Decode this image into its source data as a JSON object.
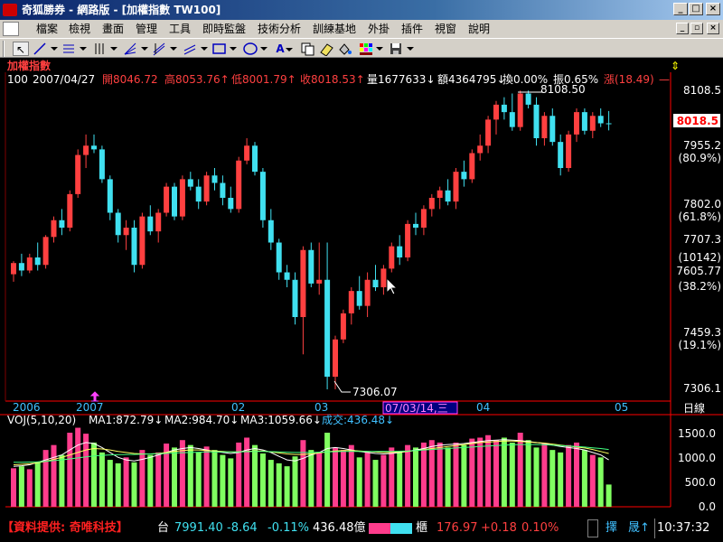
{
  "window": {
    "title": "奇狐勝券 - 網路版 - [加權指數 TW100]",
    "minimize": "_",
    "maximize": "□",
    "close": "×"
  },
  "menu": [
    "檔案",
    "檢視",
    "畫面",
    "管理",
    "工具",
    "即時監盤",
    "技術分析",
    "訓練基地",
    "外掛",
    "插件",
    "視窗",
    "說明"
  ],
  "mdi": {
    "minimize": "_",
    "restore": "▫",
    "close": "×"
  },
  "toolbar": {
    "a_label": "A",
    "arrow": "↖"
  },
  "header": {
    "name": "加權指數",
    "anchor": "⇕",
    "period": "100",
    "date": "2007/04/27",
    "open": "開8046.72",
    "high": "高8053.76↑",
    "low": "低8001.79↑",
    "close": "收8018.53↑",
    "volume": "量1677633↓",
    "amount": "額4364795↓",
    "turnover": "換0.00%",
    "amplitude": "振0.65%",
    "change": "漲(18.49)",
    "change_end": "—"
  },
  "chart_data": {
    "type": "candlestick",
    "price_axis": {
      "labels": [
        "8108.5",
        "7955.2",
        "(80.9%)",
        "7802.0",
        "(61.8%)",
        "7707.3",
        "(10142)",
        "7605.77",
        "(38.2%)",
        "7459.3",
        "(19.1%)",
        "7306.1"
      ],
      "range": [
        7306.1,
        8108.5
      ],
      "current": "8018.5"
    },
    "annotations": {
      "high": "8108.50",
      "low": "7306.07"
    },
    "time_axis": {
      "labels": [
        "2006",
        "2007",
        "02",
        "03",
        "07/03/14,三",
        "04",
        "05"
      ],
      "period": "日線"
    },
    "indicator_header": {
      "name": "VOJ(5,10,20)",
      "ma1": "MA1:872.79↓",
      "ma2": "MA2:984.70↓",
      "ma3": "MA3:1059.66↓",
      "deal": "成交:436.48↓"
    },
    "volume_axis": {
      "labels": [
        "1500.0",
        "1000.0",
        "500.0",
        "0.0"
      ],
      "range": [
        0,
        1500
      ]
    },
    "candles": [
      {
        "o": 7615,
        "h": 7650,
        "l": 7595,
        "c": 7645
      },
      {
        "o": 7645,
        "h": 7670,
        "l": 7610,
        "c": 7625
      },
      {
        "o": 7625,
        "h": 7670,
        "l": 7618,
        "c": 7660
      },
      {
        "o": 7660,
        "h": 7700,
        "l": 7625,
        "c": 7640
      },
      {
        "o": 7640,
        "h": 7720,
        "l": 7630,
        "c": 7715
      },
      {
        "o": 7715,
        "h": 7770,
        "l": 7700,
        "c": 7760
      },
      {
        "o": 7760,
        "h": 7790,
        "l": 7720,
        "c": 7740
      },
      {
        "o": 7740,
        "h": 7840,
        "l": 7730,
        "c": 7830
      },
      {
        "o": 7830,
        "h": 7950,
        "l": 7820,
        "c": 7935
      },
      {
        "o": 7935,
        "h": 7990,
        "l": 7900,
        "c": 7960
      },
      {
        "o": 7960,
        "h": 7990,
        "l": 7940,
        "c": 7950
      },
      {
        "o": 7950,
        "h": 7960,
        "l": 7860,
        "c": 7870
      },
      {
        "o": 7870,
        "h": 7880,
        "l": 7760,
        "c": 7780
      },
      {
        "o": 7780,
        "h": 7790,
        "l": 7700,
        "c": 7720
      },
      {
        "o": 7720,
        "h": 7760,
        "l": 7680,
        "c": 7740
      },
      {
        "o": 7740,
        "h": 7760,
        "l": 7620,
        "c": 7640
      },
      {
        "o": 7640,
        "h": 7780,
        "l": 7630,
        "c": 7770
      },
      {
        "o": 7770,
        "h": 7800,
        "l": 7720,
        "c": 7730
      },
      {
        "o": 7730,
        "h": 7790,
        "l": 7700,
        "c": 7780
      },
      {
        "o": 7780,
        "h": 7860,
        "l": 7770,
        "c": 7850
      },
      {
        "o": 7850,
        "h": 7860,
        "l": 7760,
        "c": 7770
      },
      {
        "o": 7770,
        "h": 7880,
        "l": 7760,
        "c": 7870
      },
      {
        "o": 7870,
        "h": 7890,
        "l": 7840,
        "c": 7850
      },
      {
        "o": 7850,
        "h": 7870,
        "l": 7790,
        "c": 7810
      },
      {
        "o": 7810,
        "h": 7890,
        "l": 7800,
        "c": 7880
      },
      {
        "o": 7880,
        "h": 7900,
        "l": 7840,
        "c": 7860
      },
      {
        "o": 7860,
        "h": 7880,
        "l": 7800,
        "c": 7820
      },
      {
        "o": 7820,
        "h": 7850,
        "l": 7780,
        "c": 7790
      },
      {
        "o": 7790,
        "h": 7930,
        "l": 7780,
        "c": 7920
      },
      {
        "o": 7920,
        "h": 7980,
        "l": 7910,
        "c": 7960
      },
      {
        "o": 7960,
        "h": 7970,
        "l": 7880,
        "c": 7890
      },
      {
        "o": 7890,
        "h": 7900,
        "l": 7740,
        "c": 7760
      },
      {
        "o": 7760,
        "h": 7790,
        "l": 7680,
        "c": 7700
      },
      {
        "o": 7700,
        "h": 7710,
        "l": 7600,
        "c": 7620
      },
      {
        "o": 7620,
        "h": 7640,
        "l": 7580,
        "c": 7600
      },
      {
        "o": 7600,
        "h": 7620,
        "l": 7480,
        "c": 7500
      },
      {
        "o": 7500,
        "h": 7690,
        "l": 7400,
        "c": 7680
      },
      {
        "o": 7680,
        "h": 7700,
        "l": 7580,
        "c": 7590
      },
      {
        "o": 7590,
        "h": 7700,
        "l": 7560,
        "c": 7600
      },
      {
        "o": 7600,
        "h": 7700,
        "l": 7306,
        "c": 7340
      },
      {
        "o": 7340,
        "h": 7450,
        "l": 7306,
        "c": 7440
      },
      {
        "o": 7440,
        "h": 7520,
        "l": 7430,
        "c": 7510
      },
      {
        "o": 7510,
        "h": 7580,
        "l": 7480,
        "c": 7570
      },
      {
        "o": 7570,
        "h": 7610,
        "l": 7520,
        "c": 7530
      },
      {
        "o": 7530,
        "h": 7620,
        "l": 7500,
        "c": 7600
      },
      {
        "o": 7600,
        "h": 7640,
        "l": 7570,
        "c": 7580
      },
      {
        "o": 7580,
        "h": 7640,
        "l": 7560,
        "c": 7630
      },
      {
        "o": 7630,
        "h": 7700,
        "l": 7620,
        "c": 7690
      },
      {
        "o": 7690,
        "h": 7720,
        "l": 7640,
        "c": 7660
      },
      {
        "o": 7660,
        "h": 7760,
        "l": 7650,
        "c": 7750
      },
      {
        "o": 7750,
        "h": 7780,
        "l": 7720,
        "c": 7740
      },
      {
        "o": 7740,
        "h": 7800,
        "l": 7720,
        "c": 7790
      },
      {
        "o": 7790,
        "h": 7830,
        "l": 7770,
        "c": 7820
      },
      {
        "o": 7820,
        "h": 7850,
        "l": 7790,
        "c": 7840
      },
      {
        "o": 7840,
        "h": 7870,
        "l": 7800,
        "c": 7810
      },
      {
        "o": 7810,
        "h": 7900,
        "l": 7790,
        "c": 7890
      },
      {
        "o": 7890,
        "h": 7920,
        "l": 7850,
        "c": 7870
      },
      {
        "o": 7870,
        "h": 7950,
        "l": 7860,
        "c": 7940
      },
      {
        "o": 7940,
        "h": 7990,
        "l": 7920,
        "c": 7960
      },
      {
        "o": 7960,
        "h": 8040,
        "l": 7940,
        "c": 8030
      },
      {
        "o": 8030,
        "h": 8080,
        "l": 7990,
        "c": 8070
      },
      {
        "o": 8070,
        "h": 8090,
        "l": 8030,
        "c": 8050
      },
      {
        "o": 8050,
        "h": 8100,
        "l": 8000,
        "c": 8010
      },
      {
        "o": 8010,
        "h": 8108,
        "l": 8000,
        "c": 8100
      },
      {
        "o": 8100,
        "h": 8108,
        "l": 8060,
        "c": 8070
      },
      {
        "o": 8070,
        "h": 8090,
        "l": 7960,
        "c": 7980
      },
      {
        "o": 7980,
        "h": 8050,
        "l": 7960,
        "c": 8040
      },
      {
        "o": 8040,
        "h": 8060,
        "l": 7960,
        "c": 7970
      },
      {
        "o": 7970,
        "h": 7990,
        "l": 7880,
        "c": 7900
      },
      {
        "o": 7900,
        "h": 8000,
        "l": 7890,
        "c": 7990
      },
      {
        "o": 7990,
        "h": 8060,
        "l": 7970,
        "c": 8050
      },
      {
        "o": 8050,
        "h": 8060,
        "l": 7990,
        "c": 8000
      },
      {
        "o": 8000,
        "h": 8050,
        "l": 7980,
        "c": 8040
      },
      {
        "o": 8040,
        "h": 8060,
        "l": 8010,
        "c": 8020
      },
      {
        "o": 8020,
        "h": 8053,
        "l": 8001,
        "c": 8018
      }
    ],
    "volumes": [
      780,
      820,
      760,
      900,
      1150,
      1250,
      1050,
      1500,
      1600,
      1480,
      1300,
      1100,
      950,
      880,
      1000,
      900,
      1150,
      1050,
      1100,
      1280,
      1200,
      1350,
      1250,
      1100,
      1220,
      1150,
      1050,
      980,
      1300,
      1400,
      1250,
      1080,
      950,
      880,
      820,
      1020,
      1350,
      1150,
      1100,
      1500,
      1200,
      1150,
      1250,
      1000,
      1100,
      950,
      1050,
      1200,
      1100,
      1250,
      1200,
      1300,
      1350,
      1300,
      1200,
      1300,
      1250,
      1380,
      1400,
      1450,
      1350,
      1400,
      1300,
      1500,
      1350,
      1200,
      1280,
      1150,
      1100,
      1250,
      1300,
      1150,
      1050,
      1000,
      450
    ],
    "ma1": [
      820,
      830,
      850,
      900,
      950,
      1000,
      1050,
      1150,
      1250,
      1300,
      1280,
      1200,
      1100,
      1000,
      950,
      930,
      960,
      1000,
      1050,
      1100,
      1150,
      1180,
      1200,
      1180,
      1150,
      1120,
      1100,
      1080,
      1100,
      1150,
      1180,
      1150,
      1100,
      1020,
      950,
      930,
      980,
      1050,
      1100,
      1180,
      1200,
      1180,
      1150,
      1120,
      1100,
      1080,
      1070,
      1080,
      1100,
      1120,
      1150,
      1180,
      1220,
      1250,
      1260,
      1270,
      1280,
      1300,
      1320,
      1340,
      1350,
      1360,
      1350,
      1340,
      1320,
      1300,
      1280,
      1250,
      1220,
      1200,
      1180,
      1150,
      1100,
      1050,
      950
    ],
    "ma2": [
      850,
      860,
      870,
      890,
      920,
      960,
      1000,
      1050,
      1100,
      1150,
      1180,
      1170,
      1150,
      1120,
      1100,
      1080,
      1070,
      1070,
      1080,
      1100,
      1120,
      1140,
      1150,
      1150,
      1140,
      1130,
      1120,
      1110,
      1110,
      1120,
      1130,
      1130,
      1110,
      1090,
      1070,
      1060,
      1060,
      1070,
      1090,
      1110,
      1130,
      1140,
      1140,
      1130,
      1120,
      1110,
      1100,
      1100,
      1110,
      1120,
      1140,
      1160,
      1180,
      1200,
      1220,
      1240,
      1260,
      1280,
      1300,
      1310,
      1320,
      1330,
      1330,
      1320,
      1310,
      1300,
      1290,
      1270,
      1250,
      1230,
      1210,
      1190,
      1160,
      1120,
      1080
    ],
    "ma3": [
      900,
      900,
      905,
      910,
      920,
      935,
      950,
      970,
      990,
      1010,
      1030,
      1040,
      1050,
      1055,
      1060,
      1060,
      1065,
      1070,
      1075,
      1080,
      1090,
      1095,
      1100,
      1105,
      1110,
      1110,
      1110,
      1110,
      1110,
      1115,
      1120,
      1120,
      1115,
      1110,
      1105,
      1100,
      1100,
      1100,
      1105,
      1110,
      1115,
      1120,
      1120,
      1120,
      1120,
      1120,
      1120,
      1120,
      1125,
      1130,
      1140,
      1150,
      1160,
      1170,
      1180,
      1190,
      1200,
      1210,
      1220,
      1230,
      1240,
      1250,
      1255,
      1260,
      1260,
      1260,
      1255,
      1250,
      1240,
      1230,
      1220,
      1210,
      1195,
      1180,
      1160
    ]
  },
  "status": {
    "provider": "【資料提供: 奇唯科技】",
    "twse_tag": "台",
    "twse_value": "7991.40",
    "twse_change": "-8.64",
    "twse_pct": "-0.11%",
    "twse_amount": "436.48億",
    "otc_tag": "櫃",
    "otc_value": "176.97",
    "otc_change": "+0.18",
    "otc_pct": "0.10%",
    "ind1": "擇",
    "ind2": "晟↑",
    "clock": "10:37:32"
  },
  "colors": {
    "up": "#ff4040",
    "down": "#40e0f0",
    "vol_up": "#ff3c8c",
    "vol_down": "#80ff60",
    "axis": "#ff0000",
    "header_bg": "#000000"
  }
}
